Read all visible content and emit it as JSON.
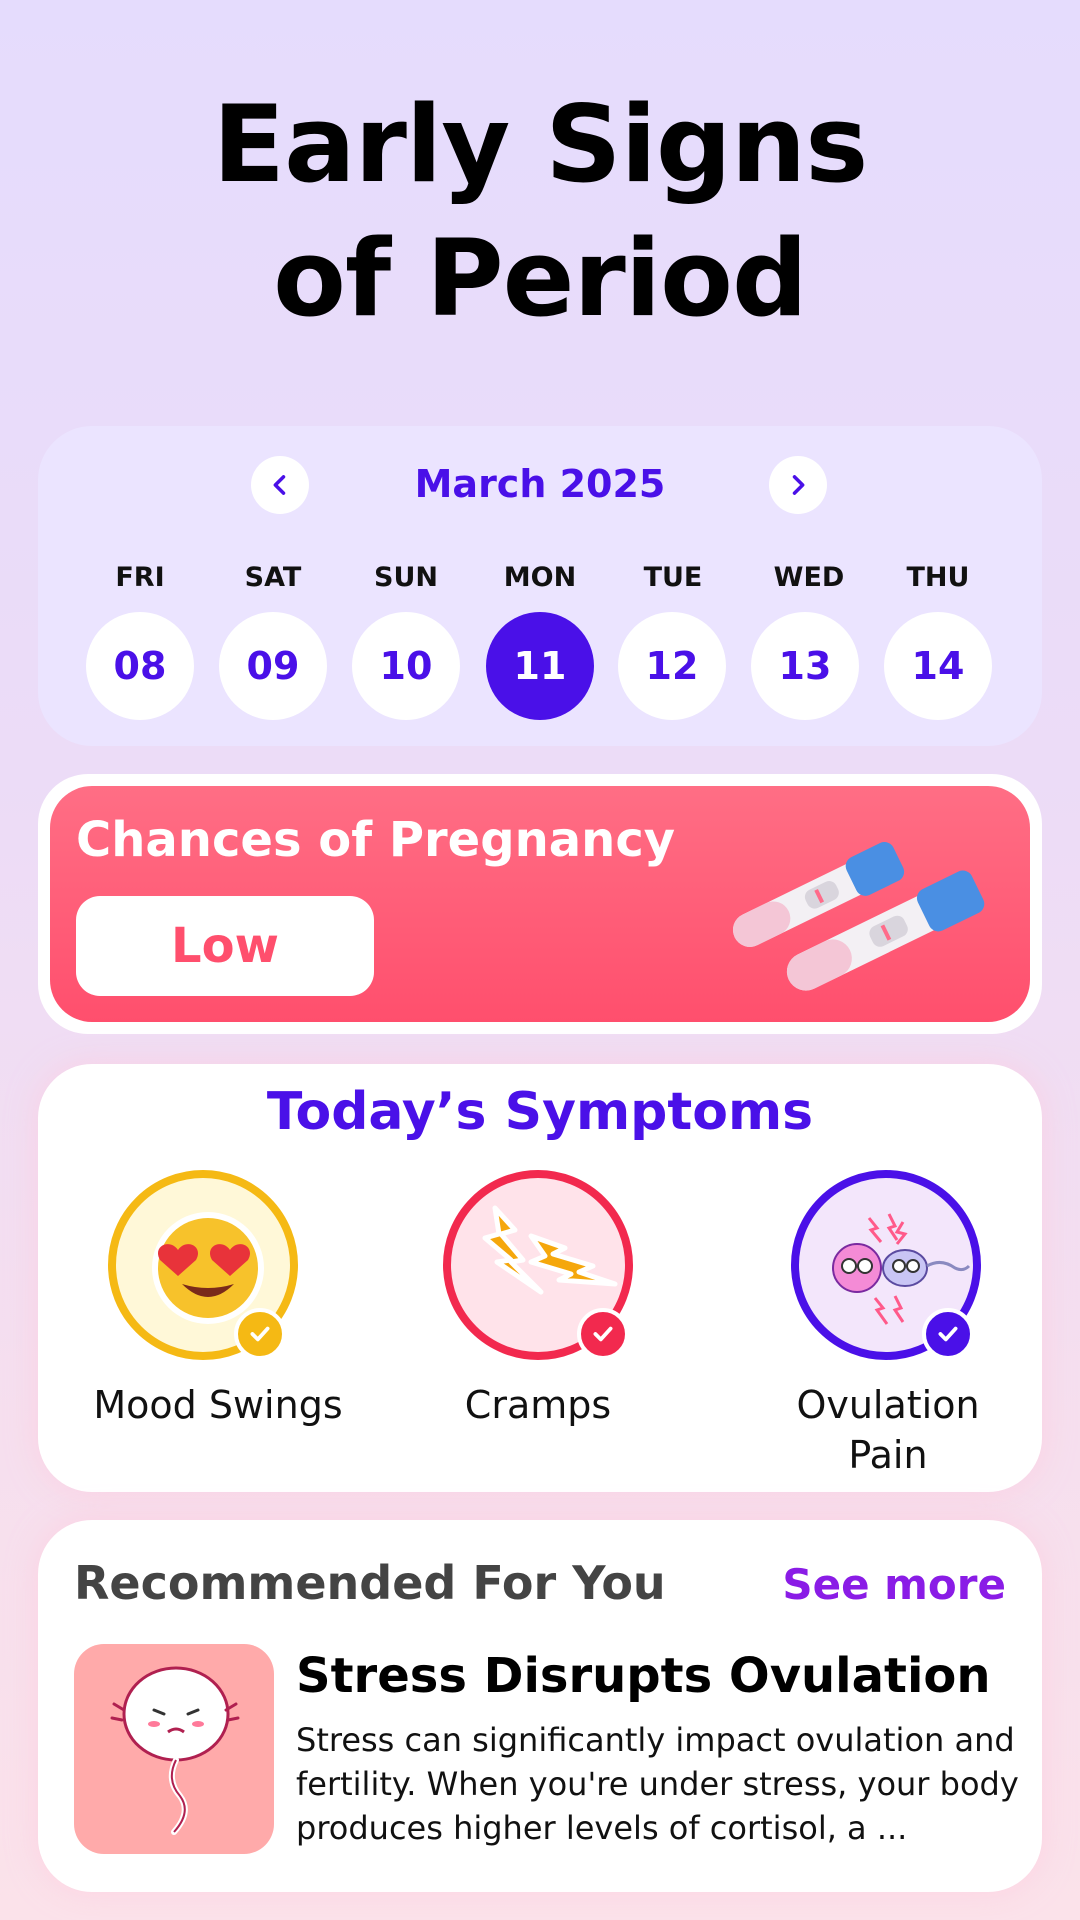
{
  "header": {
    "title_line1": "Early Signs",
    "title_line2": "of Period"
  },
  "calendar": {
    "month_label": "March 2025",
    "prev_icon": "chevron-left-icon",
    "next_icon": "chevron-right-icon",
    "days": [
      {
        "dow": "FRI",
        "date": "08",
        "selected": false
      },
      {
        "dow": "SAT",
        "date": "09",
        "selected": false
      },
      {
        "dow": "SUN",
        "date": "10",
        "selected": false
      },
      {
        "dow": "MON",
        "date": "11",
        "selected": true
      },
      {
        "dow": "TUE",
        "date": "12",
        "selected": false
      },
      {
        "dow": "WED",
        "date": "13",
        "selected": false
      },
      {
        "dow": "THU",
        "date": "14",
        "selected": false
      }
    ]
  },
  "pregnancy": {
    "title": "Chances of Pregnancy",
    "level": "Low",
    "image_icon": "pregnancy-test-icon"
  },
  "symptoms": {
    "title": "Today’s Symptoms",
    "items": [
      {
        "label": "Mood Swings",
        "icon": "heart-eyes-emoji-icon",
        "color": "#f5b914",
        "checked": true
      },
      {
        "label": "Cramps",
        "icon": "lightning-bolt-icon",
        "color": "#f2294e",
        "checked": true
      },
      {
        "label_line1": "Ovulation",
        "label_line2": "Pain",
        "icon": "ovulation-egg-icon",
        "color": "#4a10e8",
        "checked": true
      }
    ]
  },
  "recommended": {
    "title": "Recommended For You",
    "see_more": "See more",
    "article": {
      "title": "Stress Disrupts Ovulation",
      "body_line1": "Stress can significantly impact ovulation and",
      "body_line2": "fertility. When you're under stress, your body",
      "body_line3": "produces higher levels of cortisol, a ...",
      "thumbnail_icon": "stressed-egg-illustration"
    }
  },
  "colors": {
    "accent_purple": "#4a10e8",
    "pregnancy_red": "#ff4f6d",
    "see_more_purple": "#8a1ce6"
  }
}
